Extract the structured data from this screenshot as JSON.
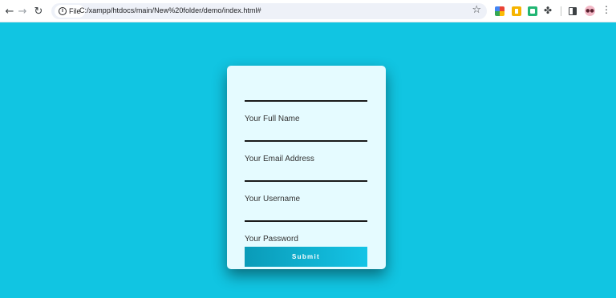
{
  "browser": {
    "site_label": "File",
    "url": "C:/xampp/htdocs/main/New%20folder/demo/index.html#",
    "avatar_text": "●●"
  },
  "form": {
    "fields": [
      {
        "label": "Your Full Name"
      },
      {
        "label": "Your Email Address"
      },
      {
        "label": "Your Username"
      },
      {
        "label": "Your Password"
      }
    ],
    "submit_label": "Submit"
  },
  "colors": {
    "page_background": "#11c5e2",
    "card_background": "#e5fbff",
    "button_gradient_start": "#0a9bb8",
    "button_gradient_end": "#14c4e6"
  }
}
